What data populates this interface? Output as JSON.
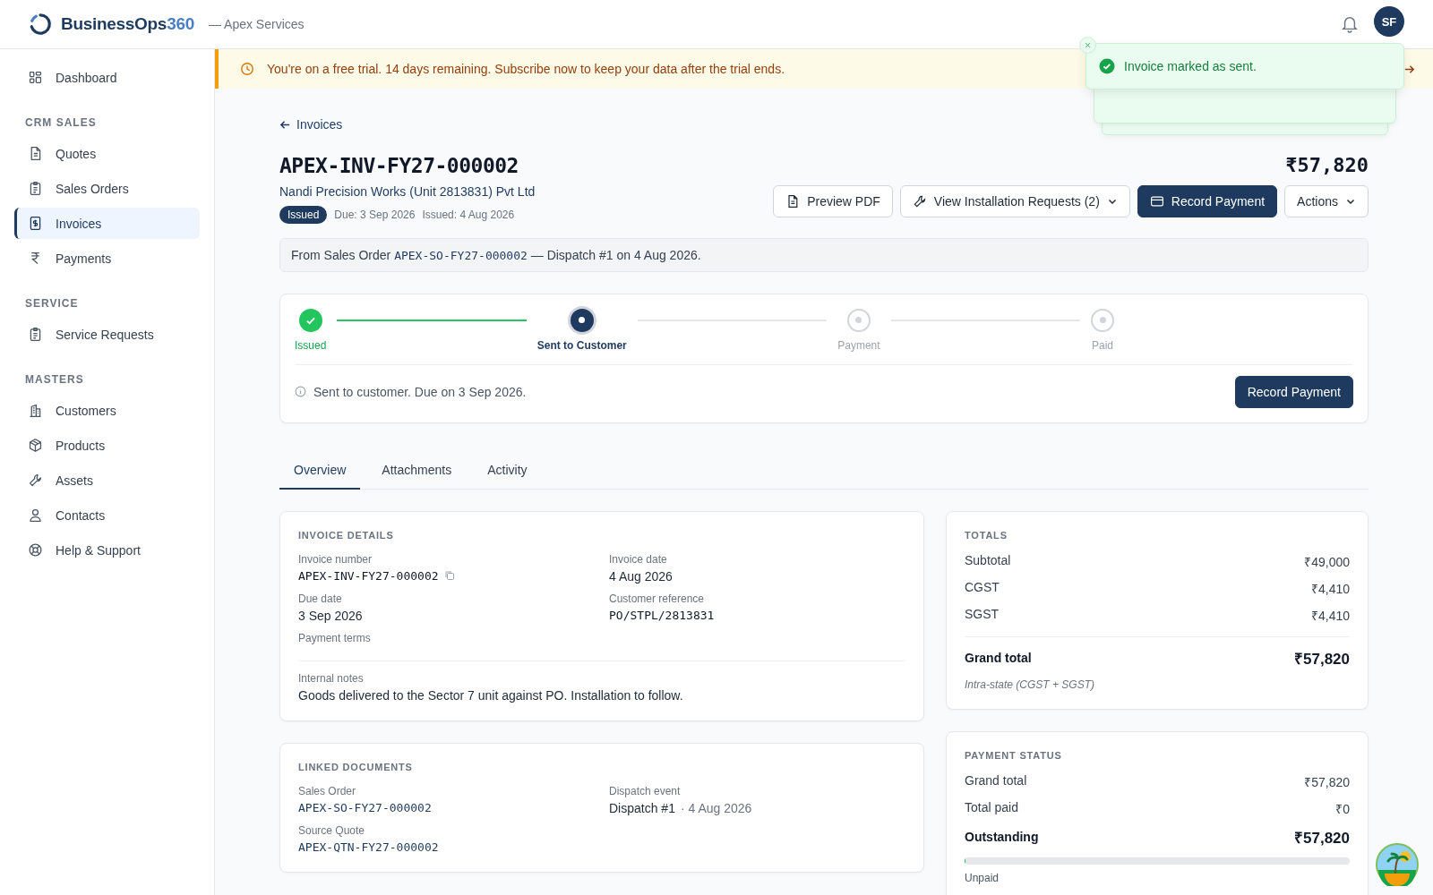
{
  "brand": {
    "name": "BusinessOps",
    "suffix": "360",
    "org": "— Apex Services"
  },
  "user": {
    "initials": "SF"
  },
  "sidebar": {
    "items": [
      {
        "kind": "link",
        "label": "Dashboard",
        "selected": false
      },
      {
        "kind": "heading",
        "label": "CRM SALES"
      },
      {
        "kind": "link",
        "label": "Quotes",
        "selected": false
      },
      {
        "kind": "link",
        "label": "Sales Orders",
        "selected": false
      },
      {
        "kind": "link",
        "label": "Invoices",
        "selected": true
      },
      {
        "kind": "link",
        "label": "Payments",
        "selected": false
      },
      {
        "kind": "heading",
        "label": "SERVICE"
      },
      {
        "kind": "link",
        "label": "Service Requests",
        "selected": false
      },
      {
        "kind": "heading",
        "label": "MASTERS"
      },
      {
        "kind": "link",
        "label": "Customers",
        "selected": false
      },
      {
        "kind": "link",
        "label": "Products",
        "selected": false
      },
      {
        "kind": "link",
        "label": "Assets",
        "selected": false
      },
      {
        "kind": "link",
        "label": "Contacts",
        "selected": false
      },
      {
        "kind": "link",
        "label": "Help & Support",
        "selected": false
      }
    ]
  },
  "trial_banner": {
    "text": "You're on a free trial. 14 days remaining. Subscribe now to keep your data after the trial ends."
  },
  "toast": {
    "message": "Invoice marked as sent."
  },
  "back_link": "Invoices",
  "invoice": {
    "number": "APEX-INV-FY27-000002",
    "customer": "Nandi Precision Works (Unit 2813831) Pvt Ltd",
    "status": "Issued",
    "due": "Due: 3 Sep 2026",
    "issued": "Issued: 4 Aug 2026",
    "amount": "₹57,820"
  },
  "actions": [
    {
      "label": "Preview PDF",
      "kind": "outline",
      "dropdown": false
    },
    {
      "label": "View Installation Requests (2)",
      "kind": "outline",
      "dropdown": true
    },
    {
      "label": "Record Payment",
      "kind": "primary",
      "dropdown": false
    },
    {
      "label": "Actions",
      "kind": "outline",
      "dropdown": true
    }
  ],
  "source_note": {
    "prefix": "From Sales Order ",
    "ref": "APEX-SO-FY27-000002",
    "suffix": " — Dispatch #1 on 4 Aug 2026."
  },
  "progress": {
    "steps": [
      {
        "label": "Issued",
        "done": true,
        "current": false
      },
      {
        "label": "Sent to Customer",
        "done": false,
        "current": true
      },
      {
        "label": "Payment",
        "done": false,
        "current": false
      },
      {
        "label": "Paid",
        "done": false,
        "current": false
      }
    ],
    "message": "Sent to customer. Due on 3 Sep 2026.",
    "button": "Record Payment"
  },
  "tabs": [
    {
      "label": "Overview",
      "selected": true
    },
    {
      "label": "Attachments",
      "selected": false
    },
    {
      "label": "Activity",
      "selected": false
    }
  ],
  "invoice_details": {
    "title": "INVOICE DETAILS",
    "fields": [
      {
        "label": "Invoice number",
        "value": "APEX-INV-FY27-000002",
        "mono": true,
        "copyable": true
      },
      {
        "label": "Invoice date",
        "value": "4 Aug 2026",
        "mono": false
      },
      {
        "label": "Due date",
        "value": "3 Sep 2026",
        "mono": false
      },
      {
        "label": "Customer reference",
        "value": "PO/STPL/2813831",
        "mono": true
      },
      {
        "label": "Payment terms"
      }
    ],
    "notes_label": "Internal notes",
    "notes": "Goods delivered to the Sector 7 unit against PO. Installation to follow."
  },
  "linked_documents": {
    "title": "LINKED DOCUMENTS",
    "fields": [
      {
        "label": "Sales Order",
        "value": "APEX-SO-FY27-000002",
        "mono": true
      },
      {
        "label": "Dispatch event",
        "value": "Dispatch #1",
        "meta": "· 4 Aug 2026",
        "mono": false
      },
      {
        "label": "Source Quote",
        "value": "APEX-QTN-FY27-000002",
        "mono": true
      }
    ]
  },
  "totals": {
    "title": "TOTALS",
    "rows": [
      {
        "label": "Subtotal",
        "value": "₹49,000"
      },
      {
        "label": "CGST",
        "value": "₹4,410"
      },
      {
        "label": "SGST",
        "value": "₹4,410"
      }
    ],
    "grand": {
      "label": "Grand total",
      "value": "₹57,820"
    },
    "note": "Intra-state (CGST + SGST)"
  },
  "payment_status": {
    "title": "PAYMENT STATUS",
    "rows": [
      {
        "label": "Grand total",
        "value": "₹57,820"
      },
      {
        "label": "Total paid",
        "value": "₹0"
      }
    ],
    "outstanding": {
      "label": "Outstanding",
      "value": "₹57,820"
    },
    "level": 0,
    "status": "Unpaid"
  }
}
